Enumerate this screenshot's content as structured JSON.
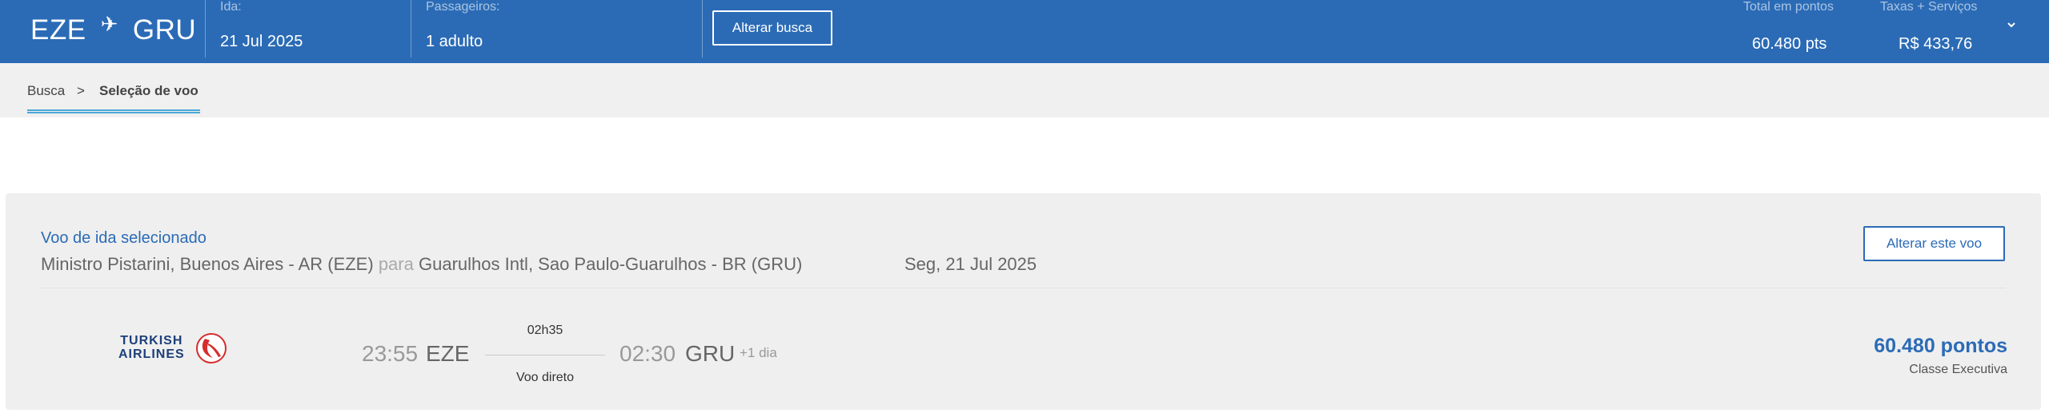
{
  "header": {
    "origin": "EZE",
    "destination": "GRU",
    "departure_label": "Ida:",
    "departure_value": "21 Jul 2025",
    "passengers_label": "Passageiros:",
    "passengers_value": "1 adulto",
    "alter_search_label": "Alterar busca",
    "points_label": "Total em pontos",
    "points_value": "60.480 pts",
    "taxes_label": "Taxas + Serviços",
    "taxes_value": "R$ 433,76"
  },
  "breadcrumb": {
    "items": [
      "Busca",
      "Seleção de voo"
    ],
    "separator": ">"
  },
  "selected_flight": {
    "title": "Voo de ida selecionado",
    "origin_full": "Ministro Pistarini, Buenos Aires - AR (EZE)",
    "connector": "para",
    "destination_full": "Guarulhos Intl, Sao Paulo-Guarulhos - BR (GRU)",
    "date": "Seg, 21 Jul 2025",
    "alter_label": "Alterar este voo",
    "airline": {
      "line1": "TURKISH",
      "line2": "AIRLINES"
    },
    "departure_time": "23:55",
    "departure_code": "EZE",
    "duration": "02h35",
    "stops": "Voo direto",
    "arrival_time": "02:30",
    "arrival_code": "GRU",
    "day_offset": "+1 dia",
    "price": "60.480 pontos",
    "cabin": "Classe Executiva"
  },
  "colors": {
    "brand_blue": "#2b6bb6",
    "breadcrumb_accent": "#4aa8d8",
    "airline_red": "#d62d2d"
  }
}
